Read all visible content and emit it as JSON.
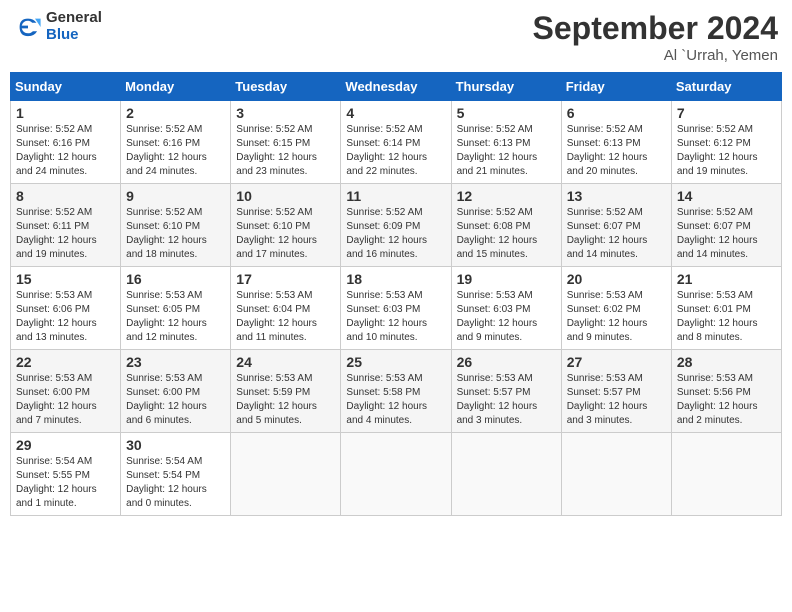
{
  "header": {
    "logo_general": "General",
    "logo_blue": "Blue",
    "month_title": "September 2024",
    "location": "Al `Urrah, Yemen"
  },
  "weekdays": [
    "Sunday",
    "Monday",
    "Tuesday",
    "Wednesday",
    "Thursday",
    "Friday",
    "Saturday"
  ],
  "weeks": [
    [
      {
        "day": "1",
        "sunrise": "5:52 AM",
        "sunset": "6:16 PM",
        "daylight": "12 hours and 24 minutes."
      },
      {
        "day": "2",
        "sunrise": "5:52 AM",
        "sunset": "6:16 PM",
        "daylight": "12 hours and 24 minutes."
      },
      {
        "day": "3",
        "sunrise": "5:52 AM",
        "sunset": "6:15 PM",
        "daylight": "12 hours and 23 minutes."
      },
      {
        "day": "4",
        "sunrise": "5:52 AM",
        "sunset": "6:14 PM",
        "daylight": "12 hours and 22 minutes."
      },
      {
        "day": "5",
        "sunrise": "5:52 AM",
        "sunset": "6:13 PM",
        "daylight": "12 hours and 21 minutes."
      },
      {
        "day": "6",
        "sunrise": "5:52 AM",
        "sunset": "6:13 PM",
        "daylight": "12 hours and 20 minutes."
      },
      {
        "day": "7",
        "sunrise": "5:52 AM",
        "sunset": "6:12 PM",
        "daylight": "12 hours and 19 minutes."
      }
    ],
    [
      {
        "day": "8",
        "sunrise": "5:52 AM",
        "sunset": "6:11 PM",
        "daylight": "12 hours and 19 minutes."
      },
      {
        "day": "9",
        "sunrise": "5:52 AM",
        "sunset": "6:10 PM",
        "daylight": "12 hours and 18 minutes."
      },
      {
        "day": "10",
        "sunrise": "5:52 AM",
        "sunset": "6:10 PM",
        "daylight": "12 hours and 17 minutes."
      },
      {
        "day": "11",
        "sunrise": "5:52 AM",
        "sunset": "6:09 PM",
        "daylight": "12 hours and 16 minutes."
      },
      {
        "day": "12",
        "sunrise": "5:52 AM",
        "sunset": "6:08 PM",
        "daylight": "12 hours and 15 minutes."
      },
      {
        "day": "13",
        "sunrise": "5:52 AM",
        "sunset": "6:07 PM",
        "daylight": "12 hours and 14 minutes."
      },
      {
        "day": "14",
        "sunrise": "5:52 AM",
        "sunset": "6:07 PM",
        "daylight": "12 hours and 14 minutes."
      }
    ],
    [
      {
        "day": "15",
        "sunrise": "5:53 AM",
        "sunset": "6:06 PM",
        "daylight": "12 hours and 13 minutes."
      },
      {
        "day": "16",
        "sunrise": "5:53 AM",
        "sunset": "6:05 PM",
        "daylight": "12 hours and 12 minutes."
      },
      {
        "day": "17",
        "sunrise": "5:53 AM",
        "sunset": "6:04 PM",
        "daylight": "12 hours and 11 minutes."
      },
      {
        "day": "18",
        "sunrise": "5:53 AM",
        "sunset": "6:03 PM",
        "daylight": "12 hours and 10 minutes."
      },
      {
        "day": "19",
        "sunrise": "5:53 AM",
        "sunset": "6:03 PM",
        "daylight": "12 hours and 9 minutes."
      },
      {
        "day": "20",
        "sunrise": "5:53 AM",
        "sunset": "6:02 PM",
        "daylight": "12 hours and 9 minutes."
      },
      {
        "day": "21",
        "sunrise": "5:53 AM",
        "sunset": "6:01 PM",
        "daylight": "12 hours and 8 minutes."
      }
    ],
    [
      {
        "day": "22",
        "sunrise": "5:53 AM",
        "sunset": "6:00 PM",
        "daylight": "12 hours and 7 minutes."
      },
      {
        "day": "23",
        "sunrise": "5:53 AM",
        "sunset": "6:00 PM",
        "daylight": "12 hours and 6 minutes."
      },
      {
        "day": "24",
        "sunrise": "5:53 AM",
        "sunset": "5:59 PM",
        "daylight": "12 hours and 5 minutes."
      },
      {
        "day": "25",
        "sunrise": "5:53 AM",
        "sunset": "5:58 PM",
        "daylight": "12 hours and 4 minutes."
      },
      {
        "day": "26",
        "sunrise": "5:53 AM",
        "sunset": "5:57 PM",
        "daylight": "12 hours and 3 minutes."
      },
      {
        "day": "27",
        "sunrise": "5:53 AM",
        "sunset": "5:57 PM",
        "daylight": "12 hours and 3 minutes."
      },
      {
        "day": "28",
        "sunrise": "5:53 AM",
        "sunset": "5:56 PM",
        "daylight": "12 hours and 2 minutes."
      }
    ],
    [
      {
        "day": "29",
        "sunrise": "5:54 AM",
        "sunset": "5:55 PM",
        "daylight": "12 hours and 1 minute."
      },
      {
        "day": "30",
        "sunrise": "5:54 AM",
        "sunset": "5:54 PM",
        "daylight": "12 hours and 0 minutes."
      },
      null,
      null,
      null,
      null,
      null
    ]
  ]
}
